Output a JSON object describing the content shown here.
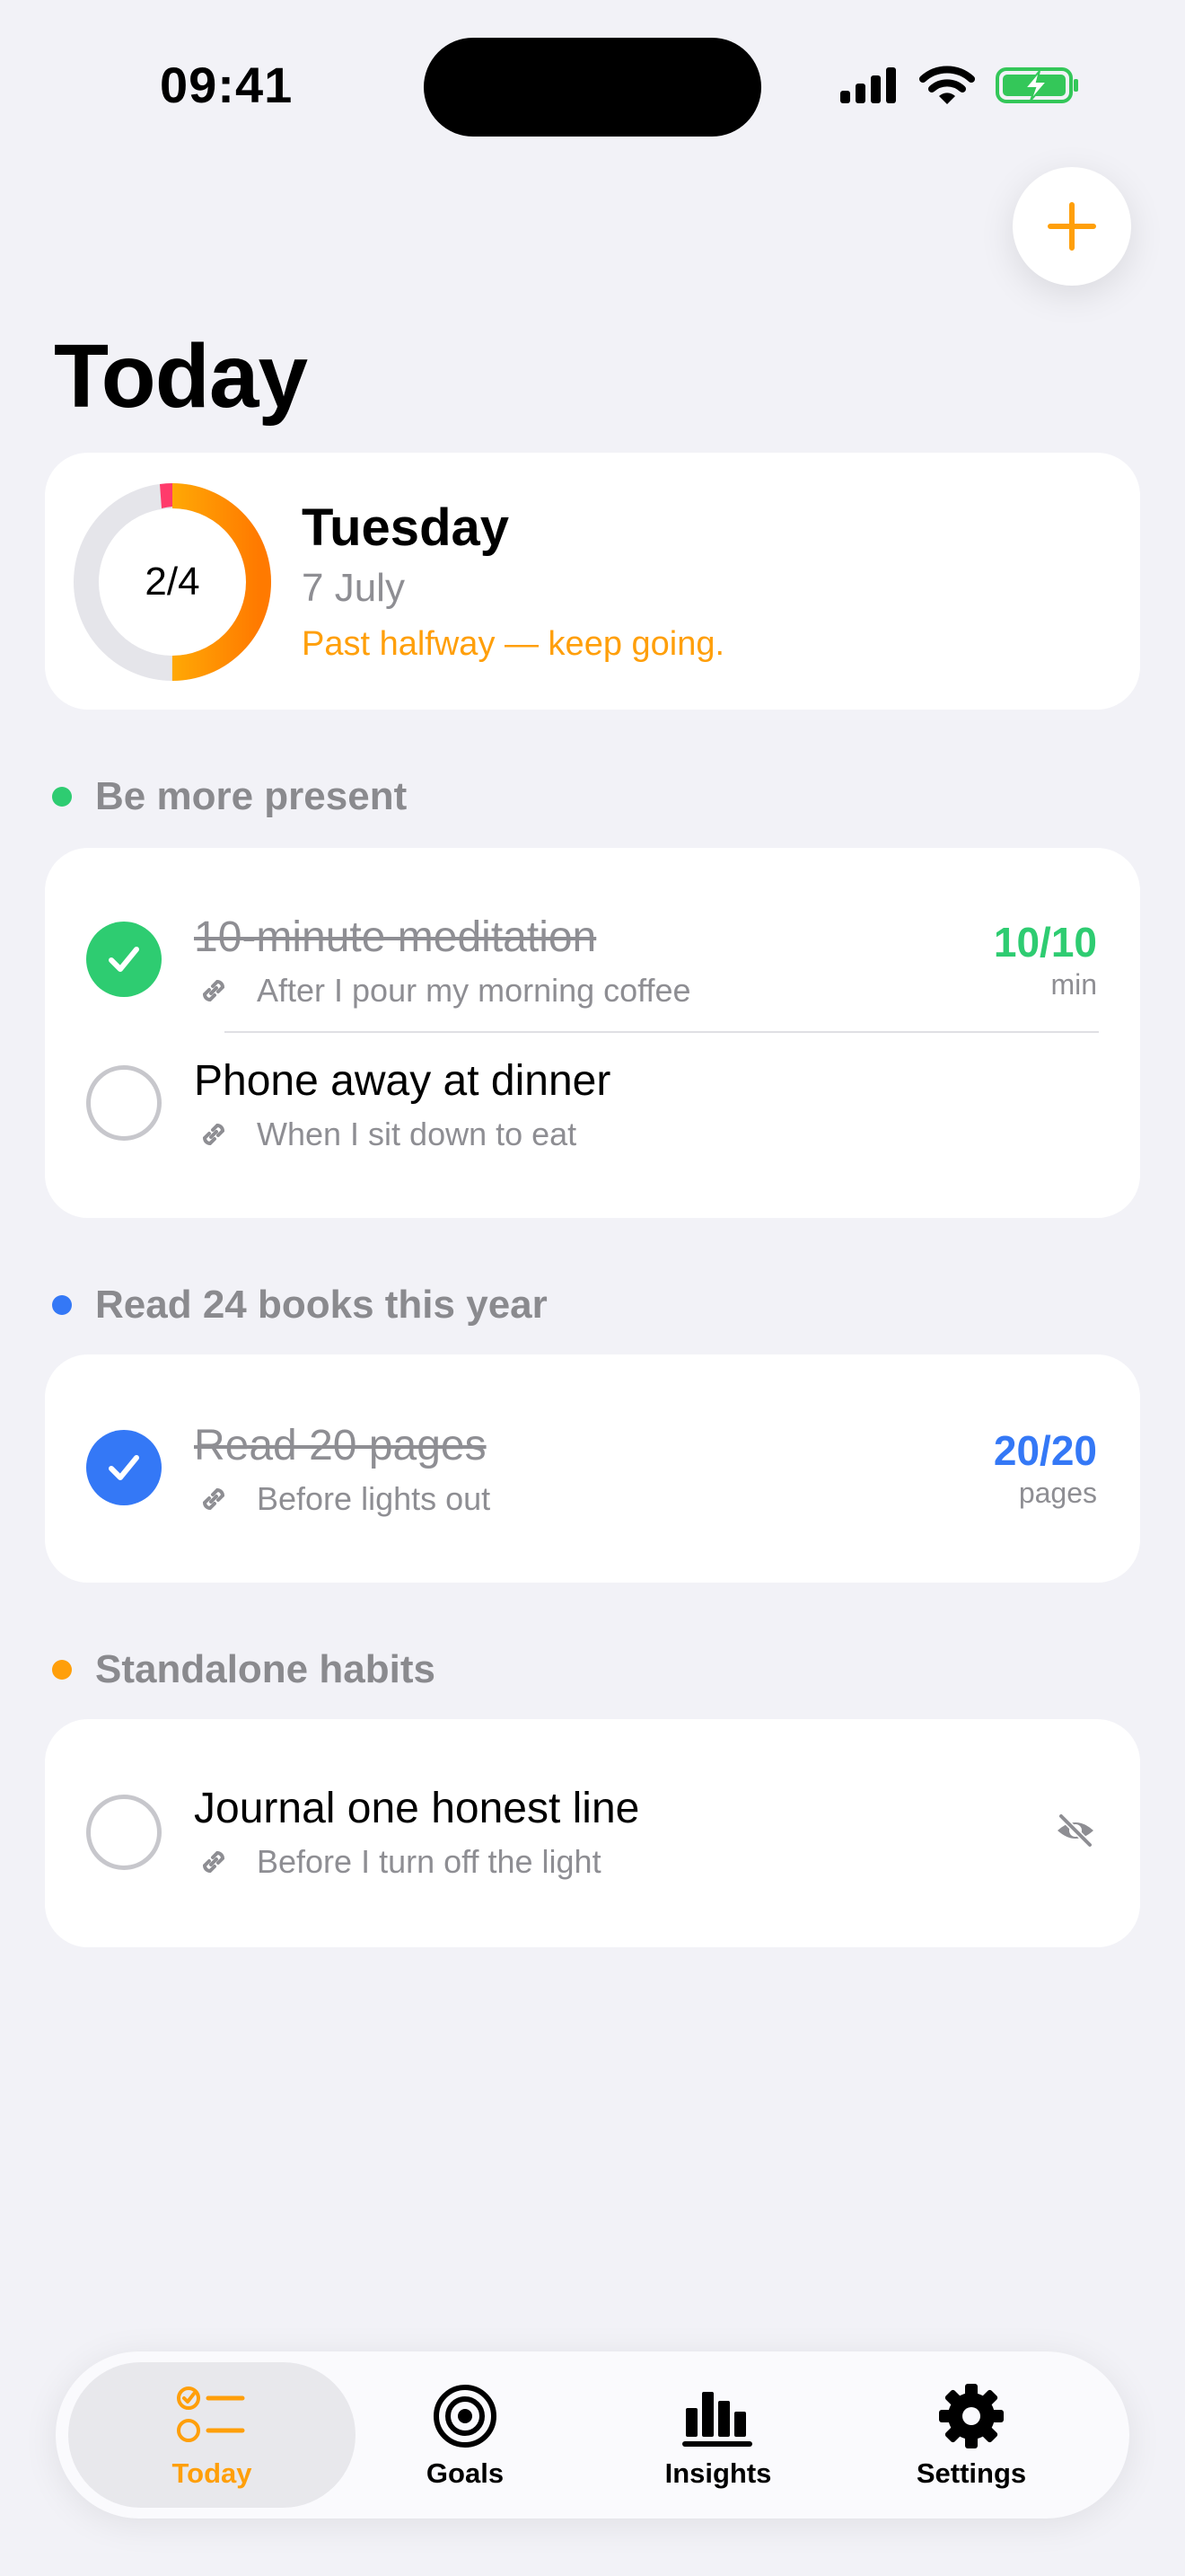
{
  "status_bar": {
    "time": "09:41"
  },
  "page": {
    "title": "Today"
  },
  "summary": {
    "progress_text": "2/4",
    "progress_fraction": 0.5,
    "day": "Tuesday",
    "date": "7 July",
    "message": "Past halfway — keep going."
  },
  "sections": [
    {
      "title": "Be more present",
      "color": "#2ecc71",
      "habits": [
        {
          "name": "10-minute meditation",
          "cue": "After I pour my morning coffee",
          "done": true,
          "progress": "10/10",
          "unit": "min"
        },
        {
          "name": "Phone away at dinner",
          "cue": "When I sit down to eat",
          "done": false
        }
      ]
    },
    {
      "title": "Read 24 books this year",
      "color": "#3478f6",
      "habits": [
        {
          "name": "Read 20 pages",
          "cue": "Before lights out",
          "done": true,
          "progress": "20/20",
          "unit": "pages"
        }
      ]
    },
    {
      "title": "Standalone habits",
      "color": "#ff9f0a",
      "habits": [
        {
          "name": "Journal one honest line",
          "cue": "Before I turn off the light",
          "done": false,
          "icon": "eye-slash-icon"
        }
      ]
    }
  ],
  "tabs": [
    {
      "label": "Today",
      "icon": "today-list-icon",
      "active": true
    },
    {
      "label": "Goals",
      "icon": "target-icon",
      "active": false
    },
    {
      "label": "Insights",
      "icon": "bar-chart-icon",
      "active": false
    },
    {
      "label": "Settings",
      "icon": "gear-icon",
      "active": false
    }
  ],
  "colors": {
    "accent": "#ff9f0a",
    "green": "#2ecc71",
    "blue": "#3478f6",
    "background": "#f2f2f7"
  }
}
